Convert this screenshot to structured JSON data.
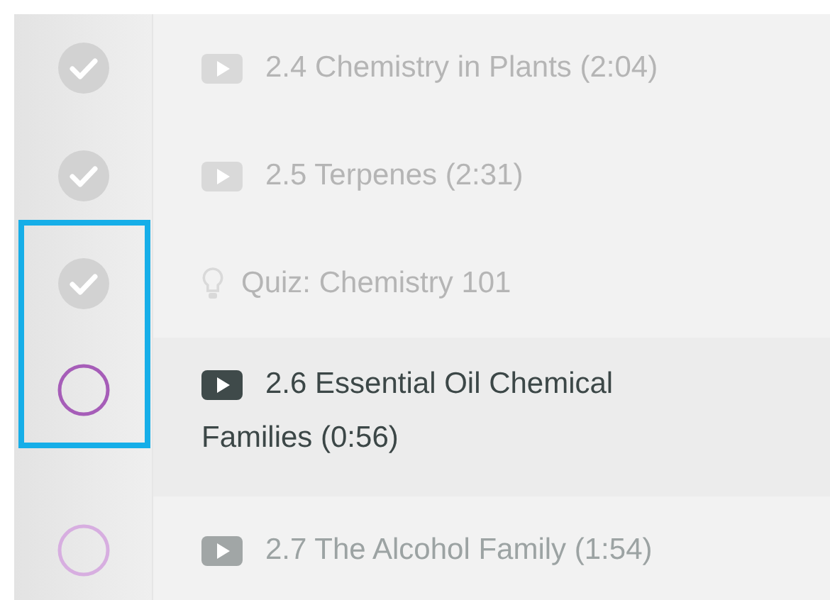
{
  "lessons": [
    {
      "kind": "video",
      "title": "2.4 Chemistry in Plants (2:04)",
      "completed": true,
      "current": false
    },
    {
      "kind": "video",
      "title": "2.5 Terpenes (2:31)",
      "completed": true,
      "current": false
    },
    {
      "kind": "quiz",
      "title": "Quiz: Chemistry 101",
      "completed": true,
      "current": false
    },
    {
      "kind": "video",
      "title": "2.6 Essential Oil Chemical Families (0:56)",
      "completed": false,
      "current": true
    },
    {
      "kind": "video",
      "title": "2.7 The Alcohol Family (1:54)",
      "completed": false,
      "current": false
    }
  ],
  "highlight_frame": {
    "shown": true
  }
}
